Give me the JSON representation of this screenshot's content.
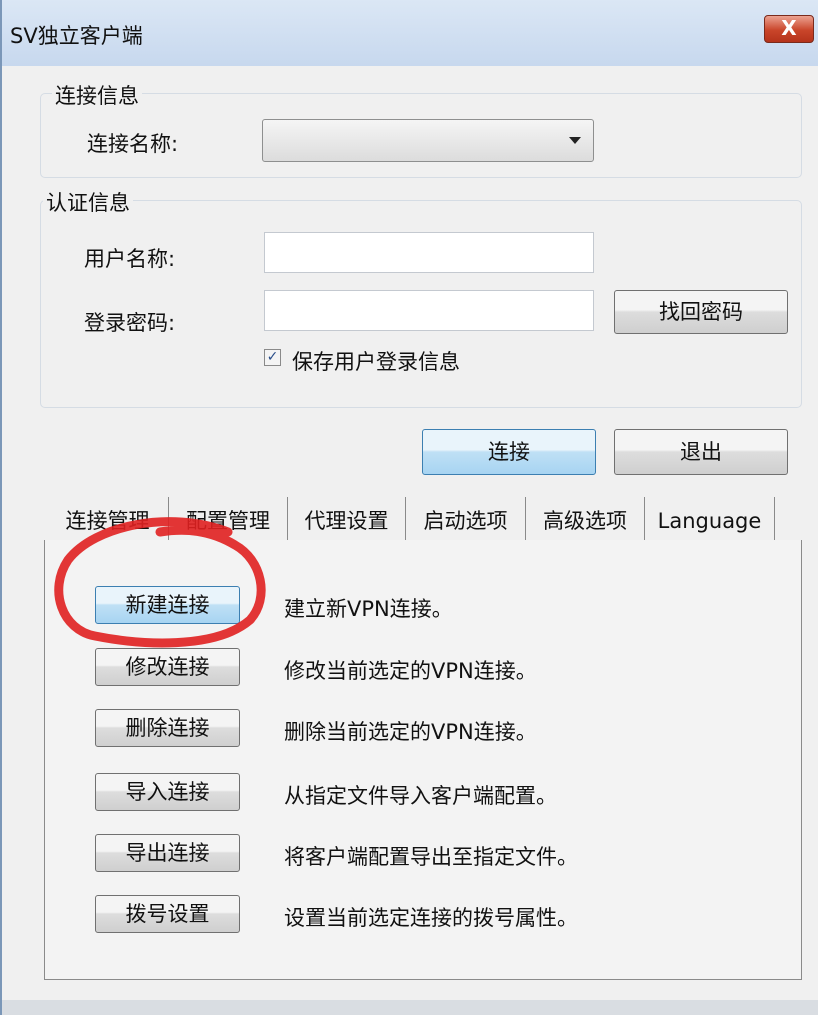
{
  "window": {
    "title": "SV独立客户端",
    "close_label": "X"
  },
  "connection_info": {
    "legend": "连接信息",
    "name_label": "连接名称:",
    "name_value": ""
  },
  "auth_info": {
    "legend": "认证信息",
    "username_label": "用户名称:",
    "username_value": "",
    "password_label": "登录密码:",
    "password_value": "",
    "recover_password_label": "找回密码",
    "remember_checked": true,
    "remember_label": "保存用户登录信息"
  },
  "actions": {
    "connect_label": "连接",
    "exit_label": "退出"
  },
  "tabs": [
    {
      "label": "连接管理",
      "active": true
    },
    {
      "label": "配置管理",
      "active": false
    },
    {
      "label": "代理设置",
      "active": false
    },
    {
      "label": "启动选项",
      "active": false
    },
    {
      "label": "高级选项",
      "active": false
    },
    {
      "label": "Language",
      "active": false
    }
  ],
  "connection_management": {
    "rows": [
      {
        "button": "新建连接",
        "description": "建立新VPN连接。"
      },
      {
        "button": "修改连接",
        "description": "修改当前选定的VPN连接。"
      },
      {
        "button": "删除连接",
        "description": "删除当前选定的VPN连接。"
      },
      {
        "button": "导入连接",
        "description": "从指定文件导入客户端配置。"
      },
      {
        "button": "导出连接",
        "description": "将客户端配置导出至指定文件。"
      },
      {
        "button": "拨号设置",
        "description": "设置当前选定连接的拨号属性。"
      }
    ]
  },
  "annotation": {
    "color": "#e02020",
    "shape": "hand-drawn circle around new-connection button"
  }
}
